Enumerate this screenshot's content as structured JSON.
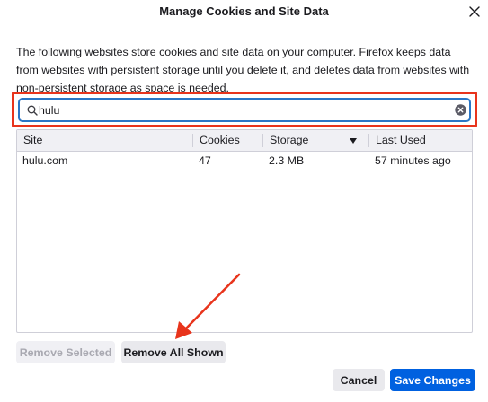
{
  "dialog": {
    "title": "Manage Cookies and Site Data",
    "description": "The following websites store cookies and site data on your computer. Firefox keeps data from websites with persistent storage until you delete it, and deletes data from websites with non-persistent storage as space is needed."
  },
  "search": {
    "value": "hulu"
  },
  "table": {
    "columns": {
      "site": "Site",
      "cookies": "Cookies",
      "storage": "Storage",
      "last_used": "Last Used"
    },
    "sorted_column": "storage",
    "rows": [
      {
        "site": "hulu.com",
        "cookies": "47",
        "storage": "2.3 MB",
        "last_used": "57 minutes ago"
      }
    ]
  },
  "buttons": {
    "remove_selected": "Remove Selected",
    "remove_all_shown": "Remove All Shown",
    "cancel": "Cancel",
    "save_changes": "Save Changes"
  },
  "icons": {
    "close": "close-icon",
    "search": "search-icon",
    "clear": "clear-icon",
    "sort": "sort-descending-icon"
  },
  "colors": {
    "highlight_box": "#e8341c",
    "focus_border": "#2a76c6",
    "primary_button": "#0061e0",
    "annotation_arrow": "#e8341c"
  }
}
